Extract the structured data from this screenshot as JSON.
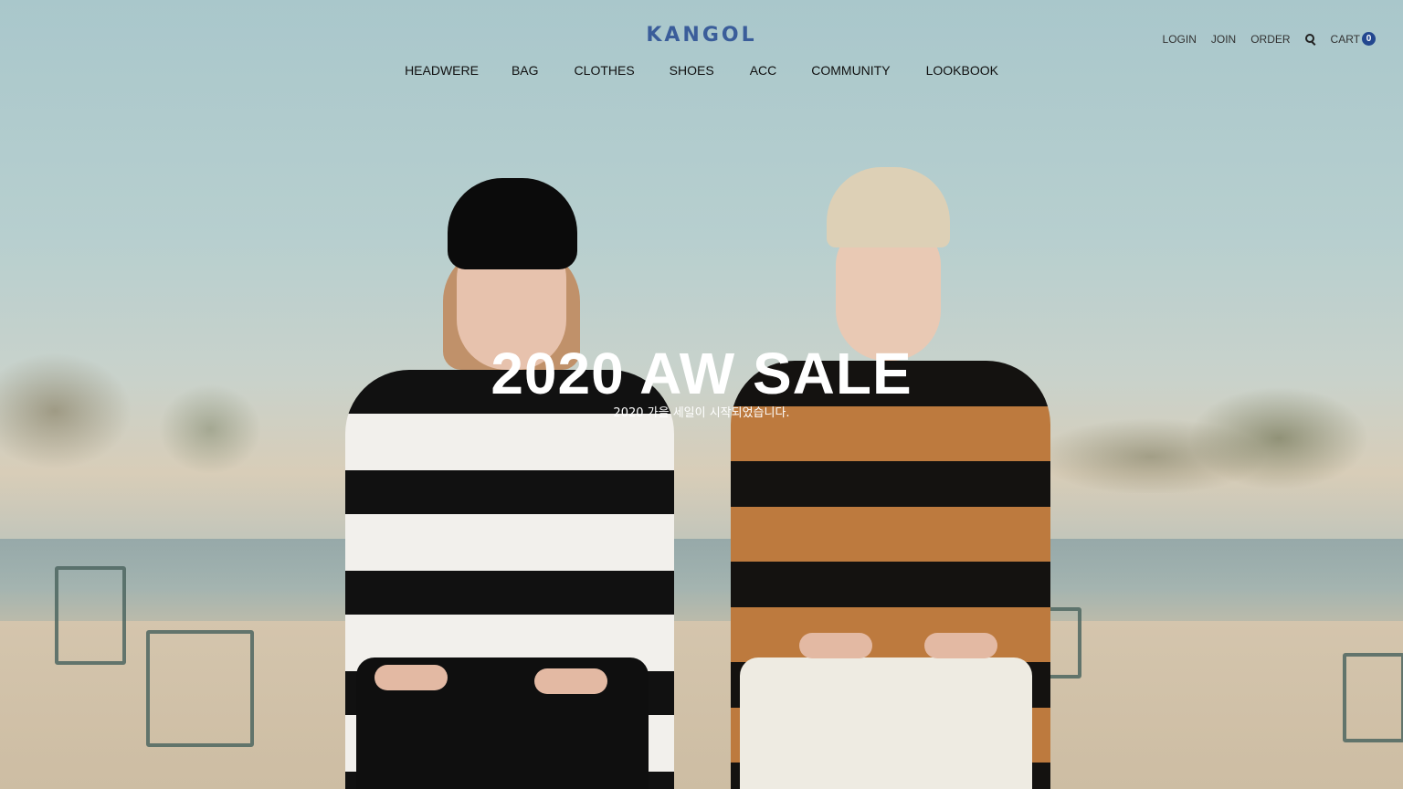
{
  "brand": {
    "logo_text": "KANGOL",
    "logo_color": "#3a5d9a"
  },
  "utility_nav": {
    "login": "LOGIN",
    "join": "JOIN",
    "order": "ORDER",
    "search_icon": "search-icon",
    "cart_label": "CART",
    "cart_count": "0",
    "cart_badge_color": "#23478f"
  },
  "main_nav": {
    "items": [
      "HEADWERE",
      "BAG",
      "CLOTHES",
      "SHOES",
      "ACC",
      "COMMUNITY",
      "LOOKBOOK"
    ]
  },
  "hero": {
    "title": "2020 AW SALE",
    "subtitle": "2020 가을 세일이 시작되었습니다."
  }
}
